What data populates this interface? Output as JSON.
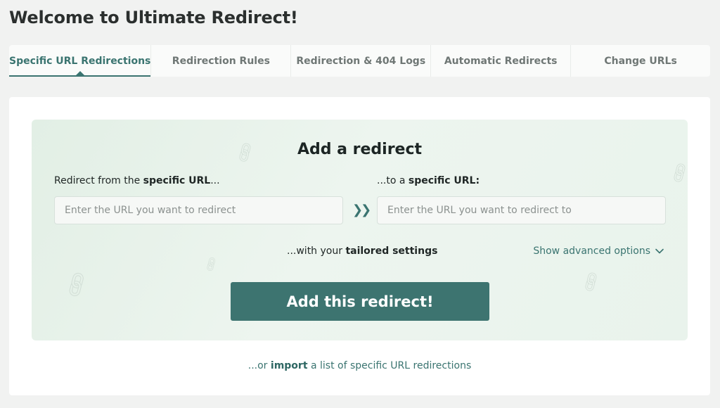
{
  "page": {
    "title": "Welcome to Ultimate Redirect!"
  },
  "tabs": [
    {
      "label": "Specific URL Redirections",
      "active": true
    },
    {
      "label": "Redirection Rules",
      "active": false
    },
    {
      "label": "Redirection & 404 Logs",
      "active": false
    },
    {
      "label": "Automatic Redirects",
      "active": false
    },
    {
      "label": "Change URLs",
      "active": false
    }
  ],
  "form": {
    "title": "Add a redirect",
    "from_label_prefix": "Redirect from the ",
    "from_label_bold": "specific URL",
    "from_label_suffix": "...",
    "from_placeholder": "Enter the URL you want to redirect",
    "to_label_prefix": "...to a ",
    "to_label_bold": "specific URL:",
    "to_placeholder": "Enter the URL you want to redirect to",
    "arrow_icon": "double-chevron-right-icon",
    "settings_prefix": "...with your ",
    "settings_bold": "tailored settings",
    "advanced_label": "Show advanced options",
    "submit_label": "Add this redirect!"
  },
  "import": {
    "prefix": "...or ",
    "link": "import",
    "suffix": " a list of specific URL redirections"
  },
  "colors": {
    "accent": "#3a7470",
    "button": "#3d7470",
    "panel_bg": "#e6f1e9",
    "page_bg": "#f1f2f1"
  }
}
